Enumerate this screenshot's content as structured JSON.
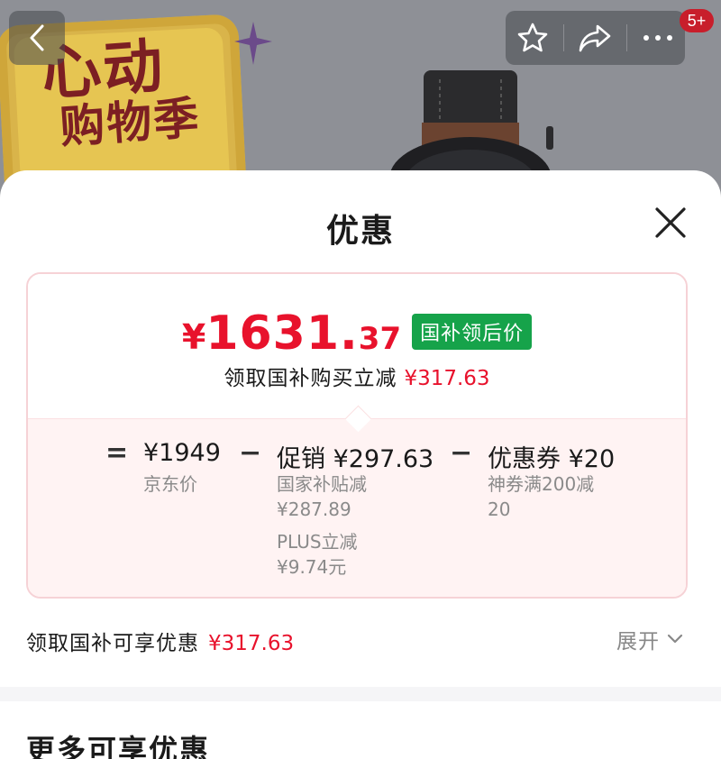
{
  "background": {
    "promo_line1": "心动",
    "promo_line2": "购物季",
    "notification_badge": "5+"
  },
  "sheet": {
    "title": "优惠"
  },
  "price_card": {
    "currency": "¥",
    "price_integer": "1631.",
    "price_decimal": "37",
    "price_tag": "国补领后价",
    "subsidy_text": "领取国补购买立减",
    "subsidy_amount": "¥317.63"
  },
  "breakdown": {
    "equals": "=",
    "jd_price": "¥1949",
    "jd_price_label": "京东价",
    "minus1": "−",
    "promo_title": "促销 ¥297.63",
    "promo_detail1_line1": "国家补贴减",
    "promo_detail1_line2": "¥287.89",
    "promo_detail2_line1": "PLUS立减",
    "promo_detail2_line2": "¥9.74元",
    "minus2": "−",
    "coupon_title": "优惠券 ¥20",
    "coupon_detail_line1": "神券满200减",
    "coupon_detail_line2": "20"
  },
  "footer": {
    "text": "领取国补可享优惠",
    "amount": "¥317.63",
    "expand_label": "展开"
  },
  "more_section": {
    "title": "更多可享优惠"
  },
  "colors": {
    "accent_red": "#e8122c",
    "tag_green": "#16a34a",
    "card_border": "#f6d2d6",
    "card_bottom_bg": "#fff3f3"
  },
  "icons": [
    "back-icon",
    "star-icon",
    "share-icon",
    "more-icon",
    "close-icon",
    "chevron-down-icon"
  ]
}
